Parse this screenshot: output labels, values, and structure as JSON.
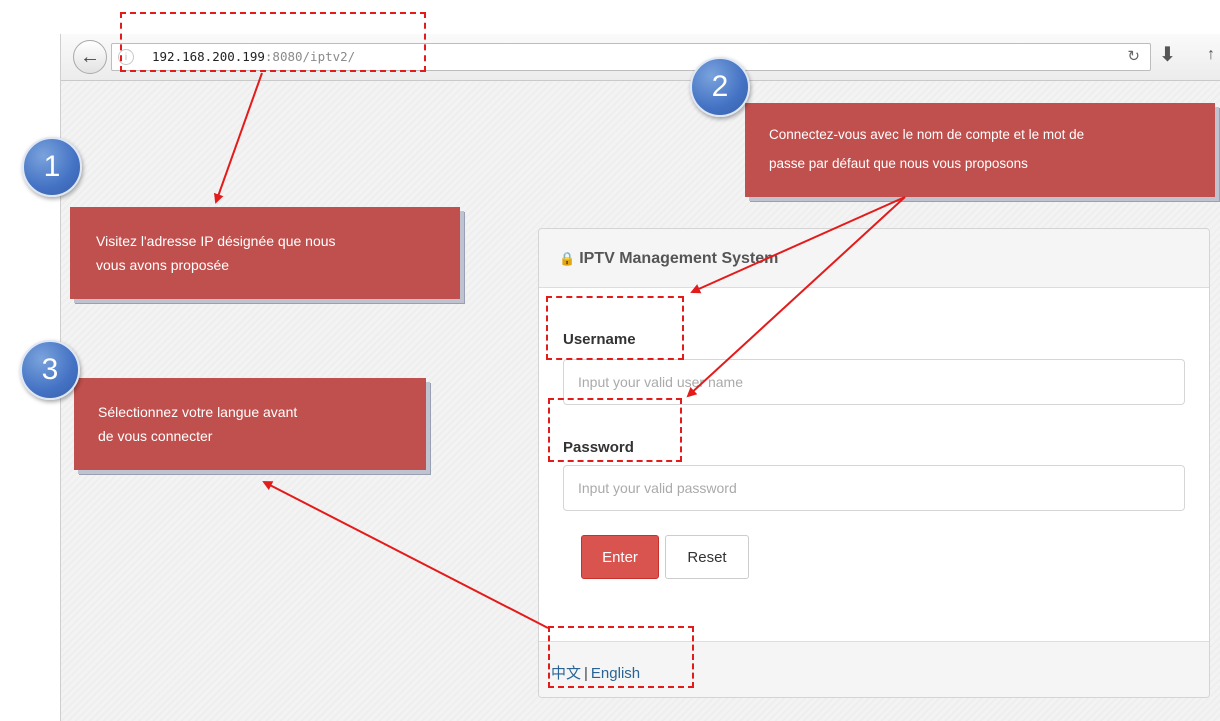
{
  "browser": {
    "url_host": "192.168.200.199",
    "url_rest": ":8080/iptv2/",
    "icons": {
      "back": "back-arrow-icon",
      "info": "info-icon",
      "reload": "reload-icon",
      "download": "download-icon",
      "home": "home-icon"
    }
  },
  "login": {
    "title": "IPTV Management System",
    "username_label": "Username",
    "username_placeholder": "Input your valid user name",
    "password_label": "Password",
    "password_placeholder": "Input your valid password",
    "enter_label": "Enter",
    "reset_label": "Reset",
    "lang_chinese": "中文",
    "lang_separator": "|",
    "lang_english": "English"
  },
  "annotations": {
    "step1": {
      "number": "1",
      "line1": "Visitez l'adresse IP désignée que nous",
      "line2": "vous avons proposée"
    },
    "step2": {
      "number": "2",
      "line1": "Connectez-vous avec le nom de compte et le mot de",
      "line2": "passe par défaut que nous vous proposons"
    },
    "step3": {
      "number": "3",
      "line1": "Sélectionnez votre langue avant",
      "line2": "de vous connecter"
    }
  },
  "colors": {
    "callout": "#c0504d",
    "badge": "#4472c4",
    "highlight": "#e31b1b",
    "enter_button": "#d9534f",
    "link": "#2a6496"
  }
}
